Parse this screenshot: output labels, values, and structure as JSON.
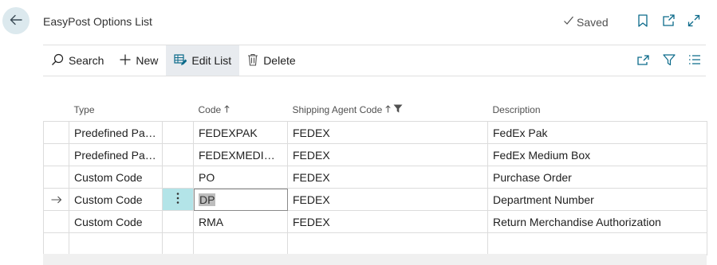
{
  "header": {
    "title": "EasyPost Options List",
    "saved_label": "Saved"
  },
  "toolbar": {
    "search_label": "Search",
    "new_label": "New",
    "edit_list_label": "Edit List",
    "delete_label": "Delete"
  },
  "columns": {
    "type": "Type",
    "code": "Code",
    "shipping_agent_code": "Shipping Agent Code",
    "description": "Description"
  },
  "rows": [
    {
      "type": "Predefined Pac...",
      "code": "FEDEXPAK",
      "agent": "FEDEX",
      "description": "FedEx Pak"
    },
    {
      "type": "Predefined Pac...",
      "code": "FEDEXMEDIUM...",
      "agent": "FEDEX",
      "description": "FedEx Medium Box"
    },
    {
      "type": "Custom Code",
      "code": "PO",
      "agent": "FEDEX",
      "description": "Purchase Order"
    },
    {
      "type": "Custom Code",
      "code": "DP",
      "agent": "FEDEX",
      "description": "Department Number"
    },
    {
      "type": "Custom Code",
      "code": "RMA",
      "agent": "FEDEX",
      "description": "Return Merchandise Authorization"
    }
  ],
  "selected_row_index": 3,
  "icons": {
    "back": "back-arrow-icon",
    "saved": "checkmark-icon",
    "bookmark": "bookmark-icon",
    "open_new": "open-new-window-icon",
    "expand": "expand-icon",
    "search": "search-icon",
    "new": "plus-icon",
    "edit_list": "edit-list-icon",
    "delete": "trash-icon",
    "share": "share-icon",
    "filter": "filter-icon",
    "list": "list-view-icon",
    "row_arrow": "row-pointer-arrow-icon",
    "row_menu": "vertical-dots-icon",
    "sort": "sort-ascending-icon",
    "column_filter": "column-filter-icon"
  },
  "colors": {
    "back_button_bg": "#dce9ee",
    "active_toolbar_bg": "#e8ebef",
    "row_menu_active_bg": "#b3e4e8",
    "accent": "#0078d4"
  }
}
